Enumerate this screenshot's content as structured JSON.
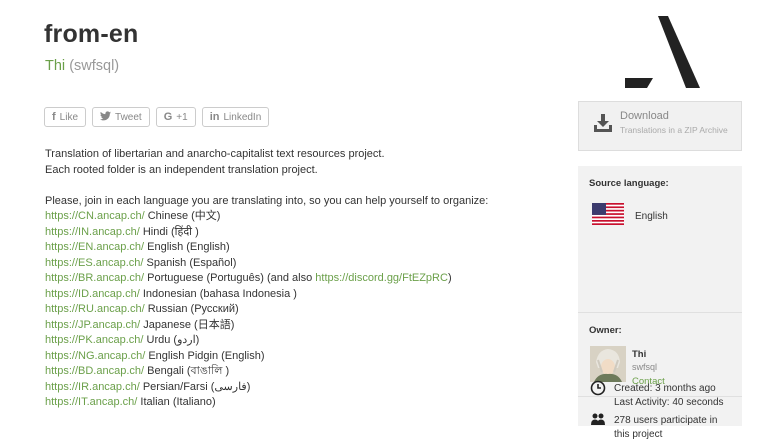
{
  "project": {
    "title": "from-en",
    "owner_display": "Thi",
    "owner_handle": "(swfsql)"
  },
  "share": [
    {
      "icon": "f",
      "label": "Like"
    },
    {
      "icon": "🐦",
      "label": "Tweet"
    },
    {
      "icon": "G",
      "label": "+1"
    },
    {
      "icon": "in",
      "label": "LinkedIn"
    }
  ],
  "description": {
    "line1": "Translation of libertarian and anarcho-capitalist text resources project.",
    "line2": "Each rooted folder is an independent translation project.",
    "intro": "Please, join in each language you are translating into, so you can help yourself to organize:",
    "languages": [
      {
        "url": "https://CN.ancap.ch/",
        "name": "Chinese (中文)"
      },
      {
        "url": "https://IN.ancap.ch/",
        "name": "Hindi (हिंदी )"
      },
      {
        "url": "https://EN.ancap.ch/",
        "name": "English (English)"
      },
      {
        "url": "https://ES.ancap.ch/",
        "name": "Spanish (Español)"
      },
      {
        "url": "https://BR.ancap.ch/",
        "name": "Portuguese (Português) (and also ",
        "extra_link": "https://discord.gg/FtEZpRC",
        "tail": ")"
      },
      {
        "url": "https://ID.ancap.ch/",
        "name": "Indonesian (bahasa Indonesia )"
      },
      {
        "url": "https://RU.ancap.ch/",
        "name": "Russian (Русский)"
      },
      {
        "url": "https://JP.ancap.ch/",
        "name": "Japanese (日本語)"
      },
      {
        "url": "https://PK.ancap.ch/",
        "name": "Urdu (اردو)"
      },
      {
        "url": "https://NG.ancap.ch/",
        "name": "English Pidgin (English)"
      },
      {
        "url": "https://BD.ancap.ch/",
        "name": "Bengali (বাঙালি )"
      },
      {
        "url": "https://IR.ancap.ch/",
        "name": "Persian/Farsi (فارسی)"
      },
      {
        "url": "https://IT.ancap.ch/",
        "name": "Italian (Italiano)"
      }
    ]
  },
  "sidebar": {
    "download_title": "Download",
    "download_sub": "Translations in a ZIP Archive",
    "source_label": "Source language:",
    "source_lang": "English",
    "owner_label": "Owner:",
    "owner_name": "Thi",
    "owner_user": "swfsql",
    "owner_contact": "Contact",
    "participants": "278 users participate in this project",
    "created": "Created: 3 months ago",
    "last_activity": "Last Activity: 40 seconds"
  },
  "colors": {
    "link": "#6ba04a",
    "sidebar_bg": "#f2f2f2"
  }
}
